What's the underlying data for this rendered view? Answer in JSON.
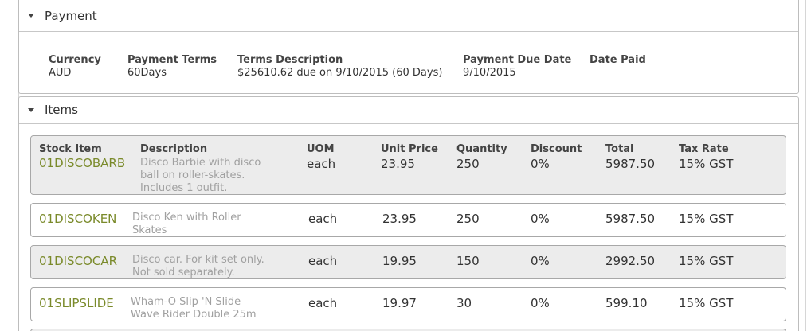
{
  "payment": {
    "title": "Payment",
    "fields": [
      {
        "label": "Currency",
        "value": "AUD"
      },
      {
        "label": "Payment Terms",
        "value": "60Days"
      },
      {
        "label": "Terms Description",
        "value": "$25610.62 due on 9/10/2015 (60 Days)"
      },
      {
        "label": "Payment Due Date",
        "value": "9/10/2015"
      },
      {
        "label": "Date Paid",
        "value": ""
      }
    ]
  },
  "items": {
    "title": "Items",
    "headers": {
      "stock_item": "Stock Item",
      "description": "Description",
      "uom": "UOM",
      "unit_price": "Unit Price",
      "quantity": "Quantity",
      "discount": "Discount",
      "total": "Total",
      "tax_rate": "Tax Rate"
    },
    "rows": [
      {
        "stock_item": "01DISCOBARB",
        "description": "Disco Barbie with disco ball on roller-skates. Includes 1 outfit.",
        "uom": "each",
        "unit_price": "23.95",
        "quantity": "250",
        "discount": "0%",
        "total": "5987.50",
        "tax_rate": "15% GST"
      },
      {
        "stock_item": "01DISCOKEN",
        "description": "Disco Ken with Roller Skates",
        "uom": "each",
        "unit_price": "23.95",
        "quantity": "250",
        "discount": "0%",
        "total": "5987.50",
        "tax_rate": "15% GST"
      },
      {
        "stock_item": "01DISCOCAR",
        "description": "Disco car. For kit set only. Not sold separately.",
        "uom": "each",
        "unit_price": "19.95",
        "quantity": "150",
        "discount": "0%",
        "total": "2992.50",
        "tax_rate": "15% GST"
      },
      {
        "stock_item": "01SLIPSLIDE",
        "description": "Wham-O Slip 'N Slide Wave Rider Double 25m",
        "uom": "each",
        "unit_price": "19.97",
        "quantity": "30",
        "discount": "0%",
        "total": "599.10",
        "tax_rate": "15% GST"
      }
    ]
  }
}
